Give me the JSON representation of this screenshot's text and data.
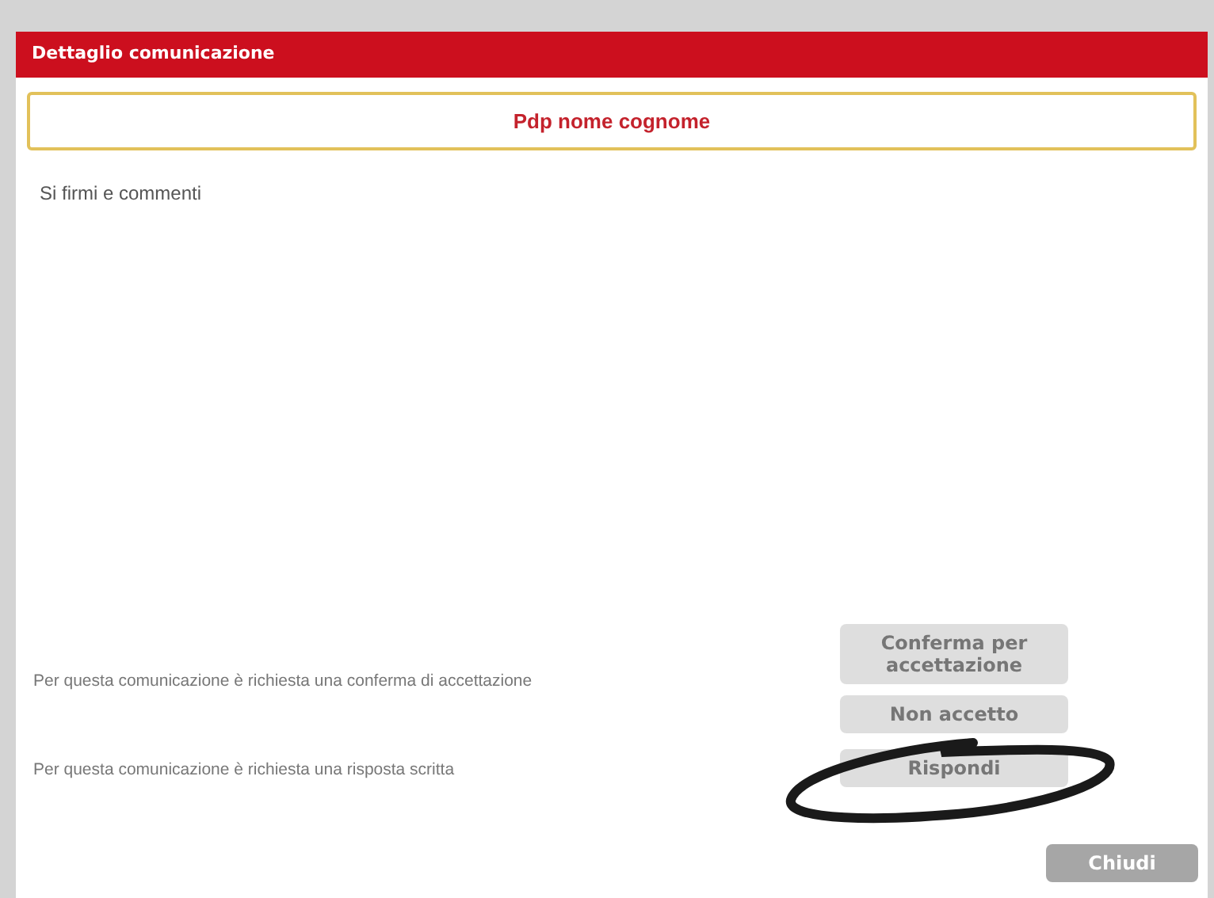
{
  "dialog": {
    "title": "Dettaglio comunicazione",
    "sender": "Pdp nome cognome",
    "message": "Si firmi e commenti"
  },
  "requests": [
    {
      "text": "Per questa comunicazione è richiesta una conferma di accettazione",
      "buttons": [
        {
          "label": "Conferma per accettazione",
          "disabled": true
        },
        {
          "label": "Non accetto",
          "disabled": true
        }
      ],
      "annotated": false
    },
    {
      "text": "Per questa comunicazione è richiesta una risposta scritta",
      "buttons": [
        {
          "label": "Rispondi",
          "disabled": true
        }
      ],
      "annotated": true
    }
  ],
  "close_button": {
    "label": "Chiudi",
    "disabled": false
  }
}
